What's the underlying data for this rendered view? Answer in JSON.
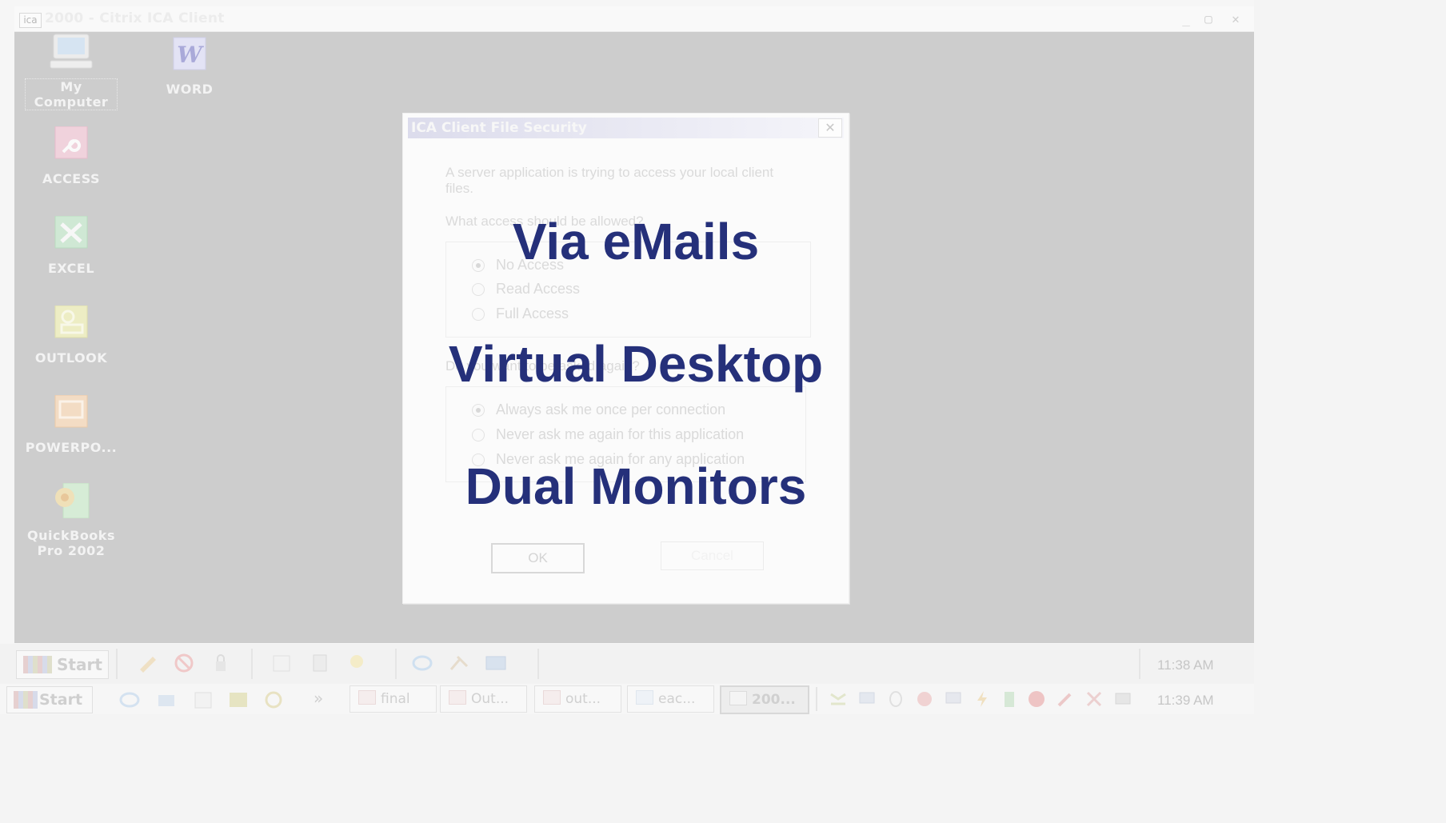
{
  "window": {
    "title": "2000 - Citrix ICA Client",
    "icon_text": "ica"
  },
  "desktop_icons": [
    {
      "label": "My Computer",
      "icon": "my-computer-icon"
    },
    {
      "label": "WORD",
      "icon": "word-icon"
    },
    {
      "label": "ACCESS",
      "icon": "access-icon"
    },
    {
      "label": "EXCEL",
      "icon": "excel-icon"
    },
    {
      "label": "OUTLOOK",
      "icon": "outlook-icon"
    },
    {
      "label": "POWERPO...",
      "icon": "powerpoint-icon"
    },
    {
      "label": "QuickBooks Pro 2002",
      "icon": "quickbooks-icon"
    }
  ],
  "dialog": {
    "title": "ICA Client File Security",
    "message": "A server application is trying to access your local client files.",
    "question1": "What access should be allowed?",
    "access_options": [
      "No Access",
      "Read Access",
      "Full Access"
    ],
    "access_selected": 0,
    "question2": "Do you want to be asked again?",
    "ask_options": [
      "Always ask me once per connection",
      "Never ask me again for this application",
      "Never ask me again for any application"
    ],
    "ask_selected": 0,
    "ok_label": "OK",
    "cancel_label": "Cancel"
  },
  "overlay_text": [
    "Via eMails",
    "Virtual Desktop",
    "Dual Monitors"
  ],
  "remote_taskbar": {
    "start_label": "Start",
    "clock": "11:38 AM"
  },
  "local_taskbar": {
    "start_label": "Start",
    "chevron": "»",
    "tasks": [
      "final",
      "Out...",
      "out...",
      "eac...",
      "200..."
    ],
    "clock": "11:39 AM"
  },
  "colors": {
    "overlay_text": "#25307a",
    "desktop_bg": "#cdcdcd"
  }
}
